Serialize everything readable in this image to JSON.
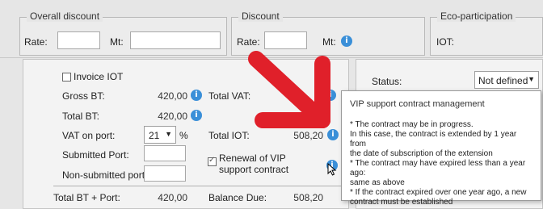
{
  "discount_bar": {
    "overall_discount_legend": "Overall discount",
    "rate_label": "Rate:",
    "mt_label": "Mt:",
    "discount_legend": "Discount",
    "discount_rate_label": "Rate:",
    "discount_mt_label": "Mt:",
    "eco_legend": "Eco-participation",
    "iot_label": "IOT:"
  },
  "totals": {
    "invoice_iot_label": "Invoice IOT",
    "gross_bt_label": "Gross BT:",
    "gross_bt_value": "420,00",
    "total_vat_label": "Total VAT:",
    "total_bt_label": "Total BT:",
    "total_bt_value": "420,00",
    "vat_on_port_label": "VAT on port:",
    "vat_on_port_value": "21",
    "percent_sign": "%",
    "total_iot_label": "Total IOT:",
    "total_iot_value": "508,20",
    "submitted_port_label": "Submitted Port:",
    "renewal_vip_label_line1": "Renewal of VIP",
    "renewal_vip_label_line2": "support contract",
    "non_submitted_port_label": "Non-submitted port:",
    "total_bt_port_label": "Total BT + Port:",
    "total_bt_port_value": "420,00",
    "balance_due_label": "Balance Due:",
    "balance_due_value": "508,20"
  },
  "status": {
    "label": "Status:",
    "selected": "Not defined"
  },
  "tooltip": {
    "title": "VIP support contract management",
    "lines": [
      "* The contract may be in progress.",
      "In this case, the contract is extended by 1 year from",
      "the date of subscription of the extension",
      "* The contract may have expired less than a year ago:",
      "same as above",
      "* If the contract expired over one year ago, a new",
      "contract must be established"
    ]
  },
  "icons": {
    "info": "info-icon",
    "arrow": "red-arrow-icon",
    "cursor": "mouse-pointer-icon"
  },
  "colors": {
    "info_blue": "#3a8fd8",
    "arrow_red": "#e0202a",
    "background": "#e6e6e6"
  }
}
